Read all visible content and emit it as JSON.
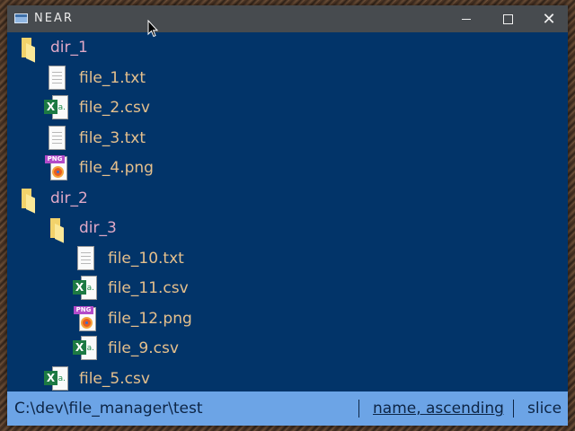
{
  "window": {
    "title": "NEAR"
  },
  "tree": [
    {
      "label": "dir_1",
      "type": "dir",
      "icon": "folder-icon",
      "depth": 0
    },
    {
      "label": "file_1.txt",
      "type": "file",
      "icon": "text-file-icon",
      "depth": 1
    },
    {
      "label": "file_2.csv",
      "type": "file",
      "icon": "excel-file-icon",
      "depth": 1
    },
    {
      "label": "file_3.txt",
      "type": "file",
      "icon": "text-file-icon",
      "depth": 1
    },
    {
      "label": "file_4.png",
      "type": "file",
      "icon": "image-file-icon",
      "depth": 1
    },
    {
      "label": "dir_2",
      "type": "dir",
      "icon": "folder-icon",
      "depth": 0
    },
    {
      "label": "dir_3",
      "type": "dir",
      "icon": "folder-icon",
      "depth": 1
    },
    {
      "label": "file_10.txt",
      "type": "file",
      "icon": "text-file-icon",
      "depth": 2
    },
    {
      "label": "file_11.csv",
      "type": "file",
      "icon": "excel-file-icon",
      "depth": 2
    },
    {
      "label": "file_12.png",
      "type": "file",
      "icon": "image-file-icon",
      "depth": 2
    },
    {
      "label": "file_9.csv",
      "type": "file",
      "icon": "excel-file-icon",
      "depth": 2
    },
    {
      "label": "file_5.csv",
      "type": "file",
      "icon": "excel-file-icon",
      "depth": 1
    }
  ],
  "statusbar": {
    "path": "C:\\dev\\file_manager\\test",
    "sort": "name, ascending",
    "mode": "slice"
  },
  "colors": {
    "background": "#023469",
    "dir_label": "#e0a8c6",
    "file_label": "#e6c08c",
    "statusbar": "#6ca4e6",
    "titlebar": "#474b4f"
  }
}
